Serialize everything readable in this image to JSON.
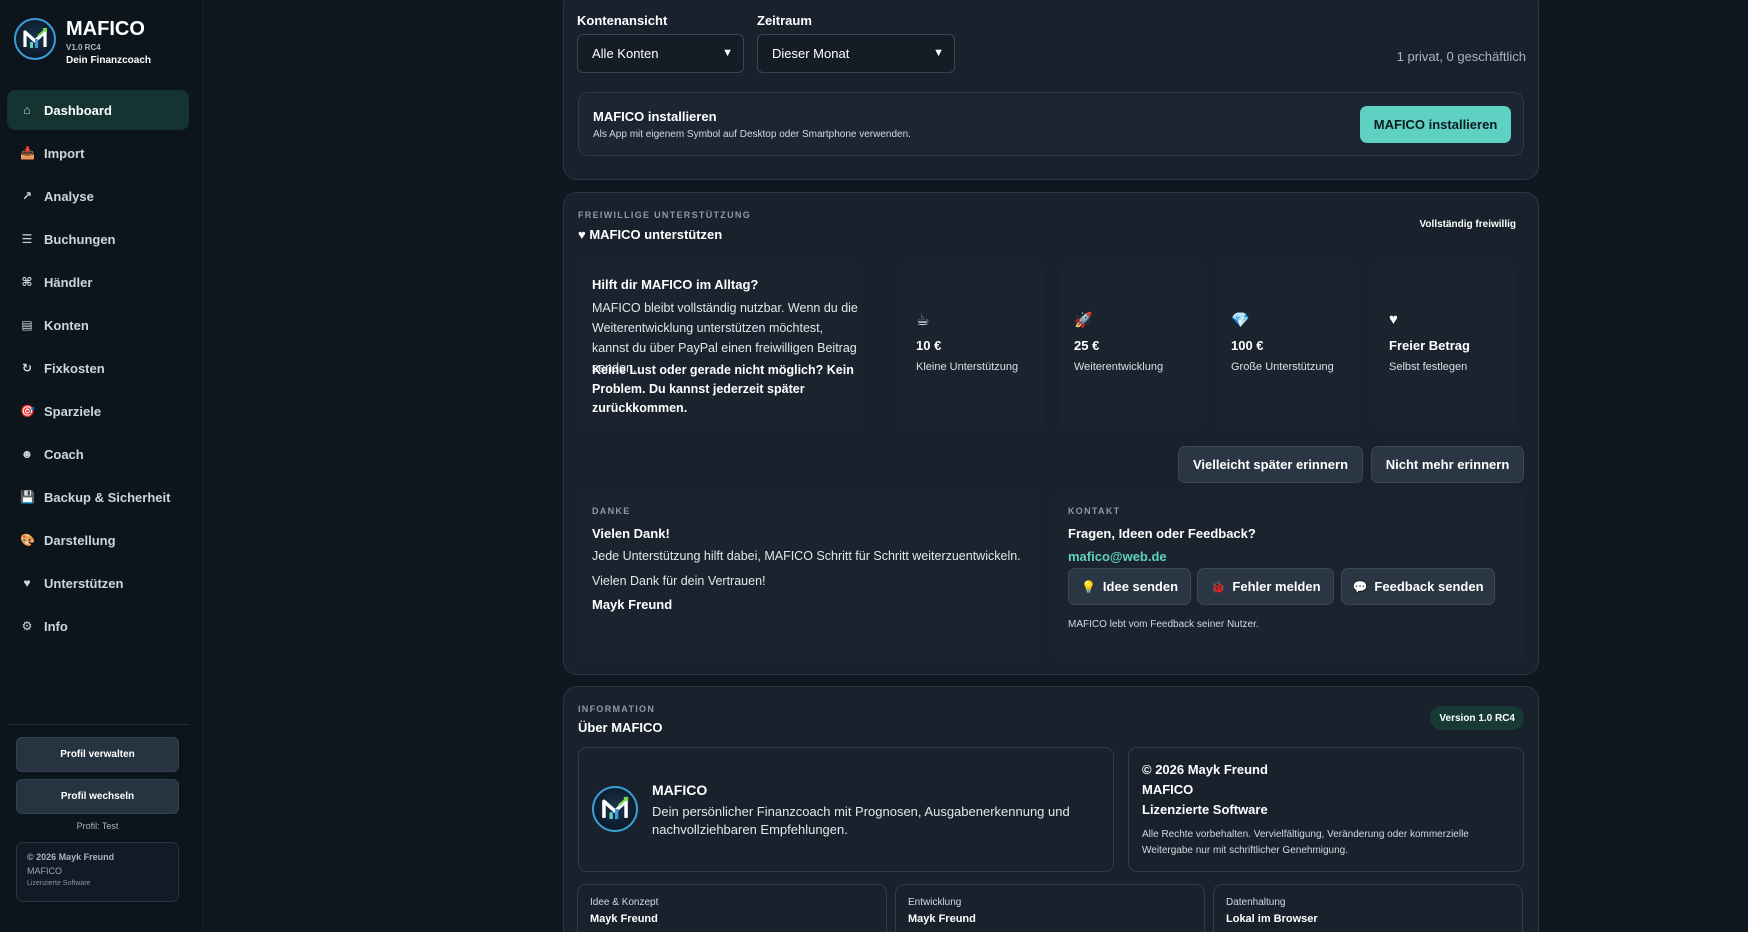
{
  "brand": {
    "name": "MAFICO",
    "version": "V1.0 RC4",
    "tagline": "Dein Finanzcoach"
  },
  "nav": [
    {
      "label": "Dashboard",
      "icon": "home-icon",
      "glyph": "⌂",
      "active": true
    },
    {
      "label": "Import",
      "icon": "inbox-icon",
      "glyph": "📥",
      "active": false
    },
    {
      "label": "Analyse",
      "icon": "trend-icon",
      "glyph": "↗",
      "active": false
    },
    {
      "label": "Buchungen",
      "icon": "list-icon",
      "glyph": "☰",
      "active": false
    },
    {
      "label": "Händler",
      "icon": "command-icon",
      "glyph": "⌘",
      "active": false
    },
    {
      "label": "Konten",
      "icon": "account-icon",
      "glyph": "▤",
      "active": false
    },
    {
      "label": "Fixkosten",
      "icon": "repeat-icon",
      "glyph": "↻",
      "active": false
    },
    {
      "label": "Sparziele",
      "icon": "target-icon",
      "glyph": "🎯",
      "active": false
    },
    {
      "label": "Coach",
      "icon": "coach-icon",
      "glyph": "☻",
      "active": false
    },
    {
      "label": "Backup & Sicherheit",
      "icon": "floppy-icon",
      "glyph": "💾",
      "active": false
    },
    {
      "label": "Darstellung",
      "icon": "palette-icon",
      "glyph": "🎨",
      "active": false
    },
    {
      "label": "Unterstützen",
      "icon": "heart-icon",
      "glyph": "♥",
      "active": false
    },
    {
      "label": "Info",
      "icon": "gear-icon",
      "glyph": "⚙",
      "active": false
    }
  ],
  "sidebar_footer": {
    "manage_profile": "Profil verwalten",
    "switch_profile": "Profil wechseln",
    "profile_label": "Profil: Test",
    "copyright": "© 2026 Mayk Freund",
    "app": "MAFICO",
    "license": "Lizenzierte Software"
  },
  "filters": {
    "account_view_label": "Kontenansicht",
    "account_view_value": "Alle Konten",
    "period_label": "Zeitraum",
    "period_value": "Dieser Monat",
    "account_count": "1 privat, 0 geschäftlich"
  },
  "install": {
    "title": "MAFICO installieren",
    "description": "Als App mit eigenem Symbol auf Desktop oder Smartphone verwenden.",
    "button": "MAFICO installieren"
  },
  "support": {
    "eyebrow": "FREIWILLIGE UNTERSTÜTZUNG",
    "title": "♥ MAFICO unterstützen",
    "badge": "Vollständig freiwillig",
    "help_title": "Hilft dir MAFICO im Alltag?",
    "help_body": "MAFICO bleibt vollständig nutzbar. Wenn du die Weiterentwicklung unterstützen möchtest, kannst du über PayPal einen freiwilligen Beitrag senden.",
    "help_bold": "Keine Lust oder gerade nicht möglich? Kein Problem. Du kannst jederzeit später zurückkommen.",
    "tiers": [
      {
        "icon": "coffee-icon",
        "glyph": "☕",
        "amount": "10 €",
        "desc": "Kleine Unterstützung"
      },
      {
        "icon": "rocket-icon",
        "glyph": "🚀",
        "amount": "25 €",
        "desc": "Weiterentwicklung"
      },
      {
        "icon": "diamond-icon",
        "glyph": "💎",
        "amount": "100 €",
        "desc": "Große Unterstützung"
      },
      {
        "icon": "heart-icon",
        "glyph": "♥",
        "amount": "Freier Betrag",
        "desc": "Selbst festlegen"
      }
    ],
    "remind_later": "Vielleicht später erinnern",
    "never_remind": "Nicht mehr erinnern",
    "thanks_eyebrow": "DANKE",
    "thanks_title": "Vielen Dank!",
    "thanks_body": "Jede Unterstützung hilft dabei, MAFICO Schritt für Schritt weiterzuentwickeln.",
    "thanks_trust": "Vielen Dank für dein Vertrauen!",
    "thanks_sign": "Mayk Freund",
    "contact_eyebrow": "KONTAKT",
    "contact_title": "Fragen, Ideen oder Feedback?",
    "contact_email": "mafico@web.de",
    "idea_button": "Idee senden",
    "bug_button": "Fehler melden",
    "feedback_button": "Feedback senden",
    "contact_note": "MAFICO lebt vom Feedback seiner Nutzer."
  },
  "about": {
    "eyebrow": "INFORMATION",
    "title": "Über MAFICO",
    "version": "Version 1.0 RC4",
    "app_name": "MAFICO",
    "app_desc": "Dein persönlicher Finanzcoach mit Prognosen, Ausgabenerkennung und nachvollziehbaren Empfehlungen.",
    "copyright": "© 2026 Mayk Freund",
    "copy_app": "MAFICO",
    "license": "Lizenzierte Software",
    "rights": "Alle Rechte vorbehalten. Vervielfältigung, Veränderung oder kommerzielle Weitergabe nur mit schriftlicher Genehmigung.",
    "meta": [
      {
        "label": "Idee & Konzept",
        "value": "Mayk Freund"
      },
      {
        "label": "Entwicklung",
        "value": "Mayk Freund"
      },
      {
        "label": "Datenhaltung",
        "value": "Lokal im Browser"
      }
    ]
  },
  "colors": {
    "accent": "#5fd1c3",
    "background": "#0f1720",
    "card": "#18212c"
  }
}
